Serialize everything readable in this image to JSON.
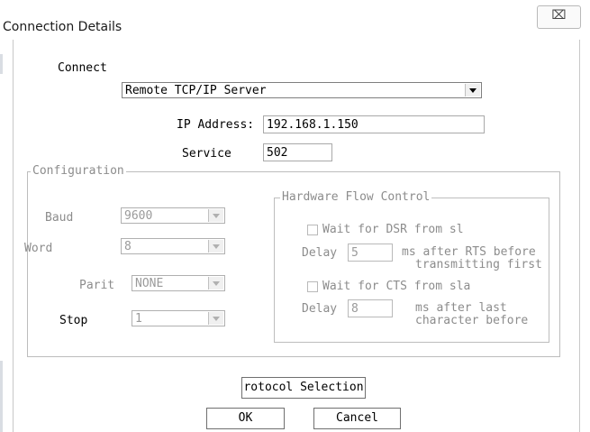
{
  "window": {
    "title": "Connection Details",
    "close_glyph": "⌧"
  },
  "connect": {
    "label": "Connect",
    "selected": "Remote TCP/IP Server",
    "ip_label": "IP Address:",
    "ip_value": "192.168.1.150",
    "service_label": "Service",
    "service_value": "502"
  },
  "configuration": {
    "legend": "Configuration",
    "baud_label": "Baud",
    "baud_value": "9600",
    "word_label": "Word",
    "word_value": "8",
    "parity_label": "Parit",
    "parity_value": "NONE",
    "stop_label": "Stop",
    "stop_value": "1"
  },
  "hardware_flow": {
    "legend": "Hardware Flow Control",
    "dsr_label": "Wait for DSR from sl",
    "delay1_label": "Delay",
    "delay1_value": "5",
    "delay1_desc1": "ms after RTS before",
    "delay1_desc2": "transmitting first",
    "cts_label": "Wait for CTS from sla",
    "delay2_label": "Delay",
    "delay2_value": "8",
    "delay2_desc1": "ms after last",
    "delay2_desc2": "character before"
  },
  "buttons": {
    "protocol": "rotocol Selection",
    "ok": "OK",
    "cancel": "Cancel"
  }
}
